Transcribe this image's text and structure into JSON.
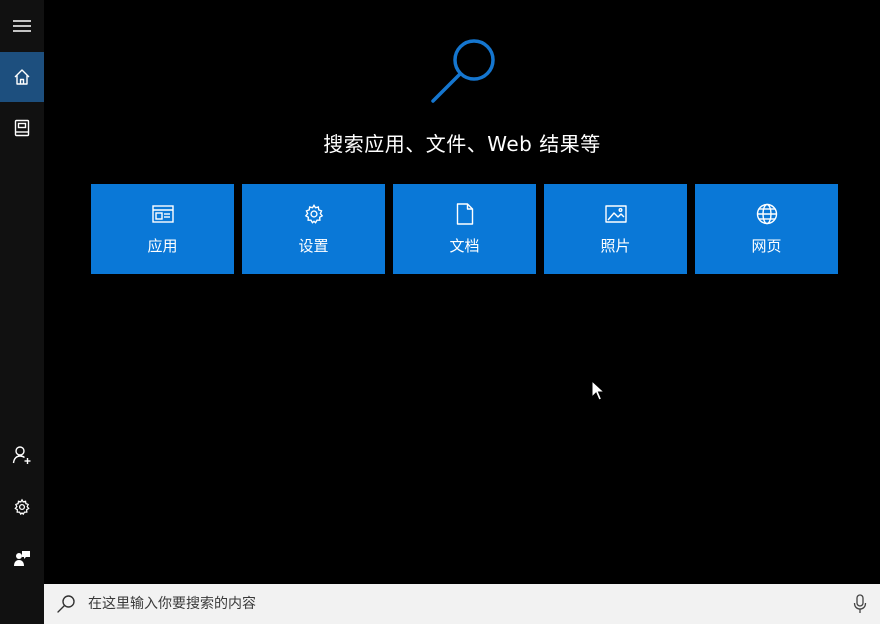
{
  "colors": {
    "tile": "#0a78d7",
    "rail": "#111111",
    "rail_active": "#1d4f7e",
    "accent_icon": "#1576cf",
    "background": "#000000",
    "searchbar": "#f2f2f2"
  },
  "rail": {
    "items": [
      {
        "icon": "hamburger-menu-icon"
      },
      {
        "icon": "home-icon",
        "active": true
      },
      {
        "icon": "notebook-icon"
      },
      {
        "icon": "add-person-icon"
      },
      {
        "icon": "gear-icon"
      },
      {
        "icon": "feedback-icon"
      }
    ]
  },
  "hero": {
    "icon": "search-icon",
    "title": "搜索应用、文件、Web 结果等"
  },
  "tiles": [
    {
      "icon": "app-window-icon",
      "label": "应用"
    },
    {
      "icon": "gear-icon",
      "label": "设置"
    },
    {
      "icon": "document-icon",
      "label": "文档"
    },
    {
      "icon": "image-icon",
      "label": "照片"
    },
    {
      "icon": "globe-icon",
      "label": "网页"
    }
  ],
  "search": {
    "placeholder": "在这里输入你要搜索的内容",
    "value": "",
    "icon": "search-icon",
    "mic_icon": "microphone-icon"
  }
}
